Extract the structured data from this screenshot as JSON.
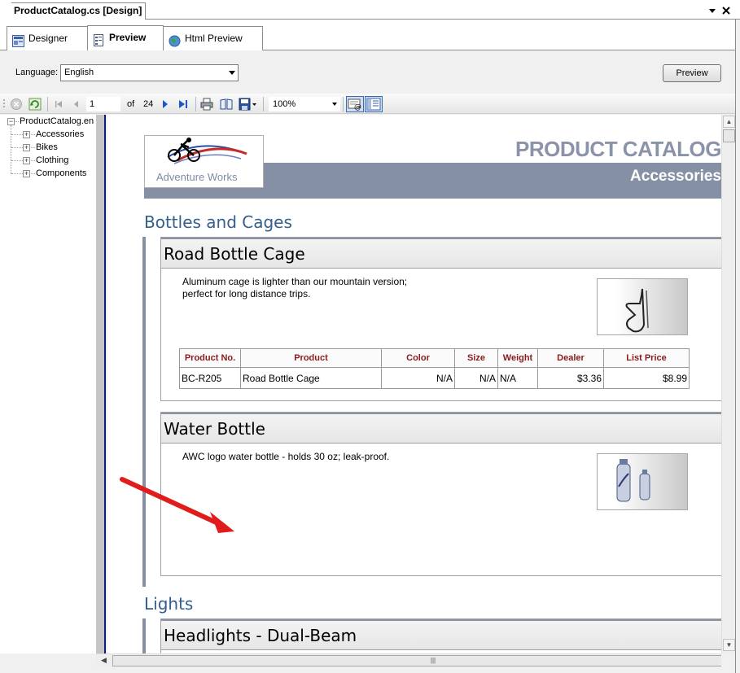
{
  "document_tab": {
    "title": "ProductCatalog.cs [Design]"
  },
  "view_tabs": [
    {
      "label": "Designer",
      "icon": "designer-icon"
    },
    {
      "label": "Preview",
      "icon": "preview-icon"
    },
    {
      "label": "Html Preview",
      "icon": "globe-icon"
    }
  ],
  "language": {
    "label": "Language:",
    "selected": "English"
  },
  "preview_button": {
    "label": "Preview"
  },
  "toolbar": {
    "page_current": "1",
    "page_of": "of",
    "page_total": "24",
    "zoom": "100%"
  },
  "tree": {
    "root": "ProductCatalog.en",
    "children": [
      "Accessories",
      "Bikes",
      "Clothing",
      "Components"
    ]
  },
  "report": {
    "header_title": "PRODUCT CATALOG",
    "header_subtitle": "Accessories",
    "logo_text": "Adventure Works",
    "categories": [
      {
        "title": "Bottles and Cages"
      },
      {
        "title": "Lights"
      }
    ],
    "products": [
      {
        "name": "Road Bottle Cage",
        "description": "Aluminum cage is lighter than our mountain version; perfect for long distance trips.",
        "image": "bottle-cage-image"
      },
      {
        "name": "Water Bottle",
        "description": "AWC logo water bottle - holds 30 oz; leak-proof.",
        "image": "water-bottle-image"
      },
      {
        "name": "Headlights - Dual-Beam"
      }
    ],
    "table_headers": [
      "Product No.",
      "Product",
      "Color",
      "Size",
      "Weight",
      "Dealer",
      "List Price"
    ],
    "table_rows": [
      [
        "BC-R205",
        "Road Bottle Cage",
        "N/A",
        "N/A",
        "N/A",
        "$3.36",
        "$8.99"
      ]
    ]
  },
  "colors": {
    "category_blue": "#335e8d",
    "header_band": "#8690a4",
    "table_header_text": "#8b1a1a",
    "annotation_arrow": "#e01c1c"
  }
}
